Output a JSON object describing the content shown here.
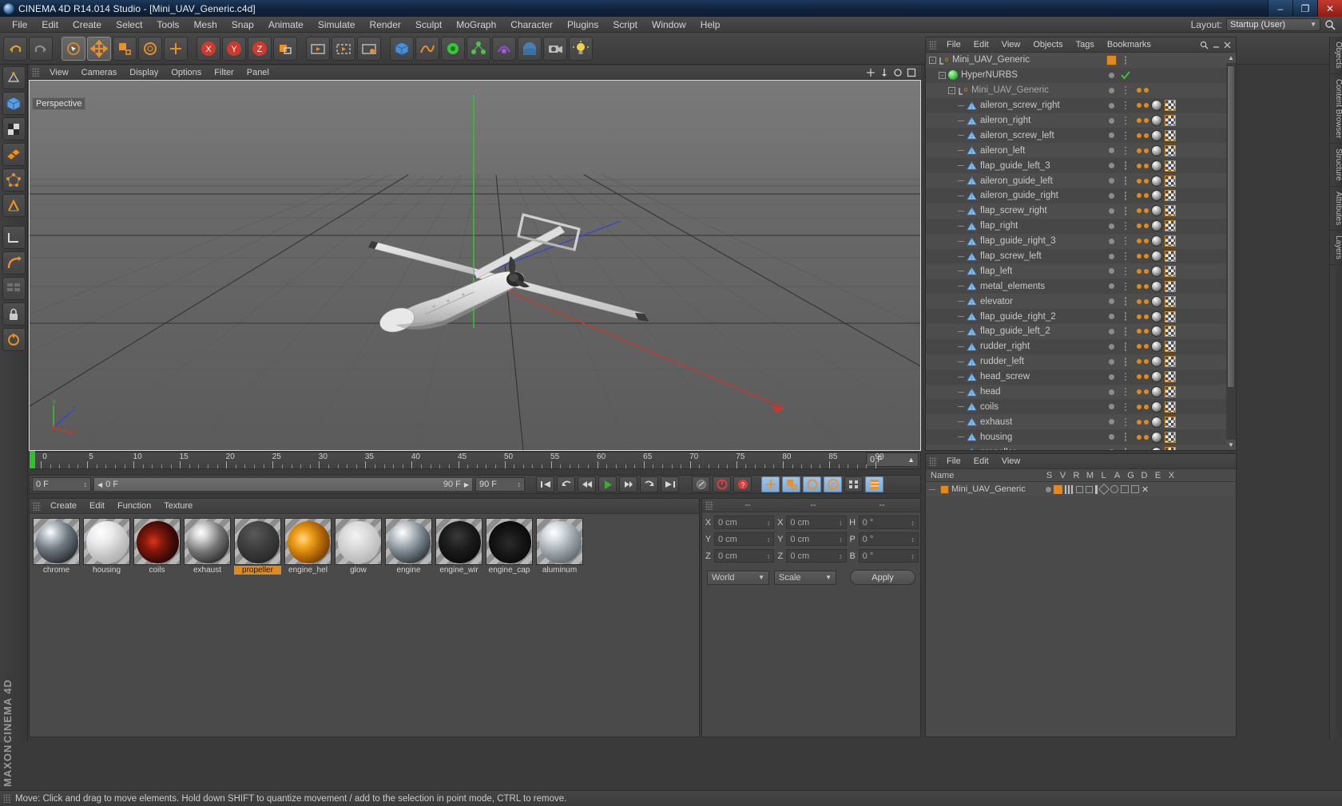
{
  "window": {
    "title": "CINEMA 4D R14.014 Studio - [Mini_UAV_Generic.c4d]",
    "app_icon": "c4d-app-icon",
    "minimize": "–",
    "maximize": "❐",
    "close": "✕"
  },
  "menubar": {
    "items": [
      "File",
      "Edit",
      "Create",
      "Select",
      "Tools",
      "Mesh",
      "Snap",
      "Animate",
      "Simulate",
      "Render",
      "Sculpt",
      "MoGraph",
      "Character",
      "Plugins",
      "Script",
      "Window",
      "Help"
    ],
    "layout_label": "Layout:",
    "layout_value": "Startup (User)",
    "search_icon": "search-icon"
  },
  "toolbar": {
    "buttons": [
      {
        "name": "undo-button",
        "icon": "undo-arrow-icon"
      },
      {
        "name": "redo-button",
        "icon": "redo-arrow-icon"
      },
      {
        "name": "live-selection-button",
        "icon": "cursor-selection-icon"
      },
      {
        "name": "move-tool-button",
        "icon": "move-arrows-icon"
      },
      {
        "name": "scale-tool-button",
        "icon": "scale-box-icon"
      },
      {
        "name": "rotate-tool-button",
        "icon": "rotate-circle-icon"
      },
      {
        "name": "add-tool-button",
        "icon": "plus-move-icon"
      },
      {
        "name": "lock-x-axis-button",
        "icon": "x-axis-icon"
      },
      {
        "name": "lock-y-axis-button",
        "icon": "y-axis-icon"
      },
      {
        "name": "lock-z-axis-button",
        "icon": "z-axis-icon"
      },
      {
        "name": "world-object-axis-button",
        "icon": "world-axis-icon"
      },
      {
        "name": "render-view-button",
        "icon": "render-view-icon"
      },
      {
        "name": "render-region-button",
        "icon": "render-region-icon"
      },
      {
        "name": "render-settings-button",
        "icon": "render-settings-icon"
      },
      {
        "name": "cube-primitive-button",
        "icon": "cube-icon"
      },
      {
        "name": "spline-button",
        "icon": "spline-icon"
      },
      {
        "name": "nurbs-button",
        "icon": "hypernurbs-icon"
      },
      {
        "name": "array-button",
        "icon": "array-icon"
      },
      {
        "name": "deformer-button",
        "icon": "deformer-icon"
      },
      {
        "name": "environment-button",
        "icon": "sky-icon"
      },
      {
        "name": "camera-button",
        "icon": "camera-icon"
      },
      {
        "name": "light-button",
        "icon": "light-bulb-icon"
      }
    ]
  },
  "left_palette": {
    "buttons": [
      {
        "name": "make-editable-tool",
        "icon": "make-editable-icon"
      },
      {
        "name": "model-mode-tool",
        "icon": "model-mode-icon"
      },
      {
        "name": "texture-mode-tool",
        "icon": "texture-mode-icon"
      },
      {
        "name": "polygon-mode-tool",
        "icon": "polygon-mode-icon"
      },
      {
        "name": "point-mode-tool",
        "icon": "point-mode-icon"
      },
      {
        "name": "edge-mode-tool",
        "icon": "edge-mode-icon"
      },
      {
        "name": "workplane-tool",
        "icon": "workplane-icon"
      },
      {
        "name": "enable-axis-tool",
        "icon": "axis-modify-icon"
      },
      {
        "name": "viewport-solo-tool",
        "icon": "viewport-solo-icon"
      },
      {
        "name": "lock-workplane-tool",
        "icon": "lock-icon"
      },
      {
        "name": "snap-tool",
        "icon": "snap-icon"
      }
    ],
    "brand_top": "MAXON",
    "brand_bottom": "CINEMA 4D"
  },
  "viewport": {
    "menu": [
      "View",
      "Cameras",
      "Display",
      "Options",
      "Filter",
      "Panel"
    ],
    "view_label": "Perspective",
    "corner_icons": [
      "pan-icon",
      "dolly-icon",
      "rotate-icon",
      "maximize-viewport-icon"
    ],
    "axis_labels": {
      "x": "X",
      "y": "Y",
      "z": "Z"
    }
  },
  "timeline": {
    "ticks": [
      0,
      5,
      10,
      15,
      20,
      25,
      30,
      35,
      40,
      45,
      50,
      55,
      60,
      65,
      70,
      75,
      80,
      85,
      90
    ],
    "end_field": "0 F",
    "playhead_frame": 0
  },
  "transport": {
    "current_frame_field": "0 F",
    "scrub_start": "0 F",
    "scrub_end": "90 F",
    "preview_end_field": "90 F",
    "buttons": [
      {
        "name": "go-to-start-button",
        "icon": "skip-start-icon"
      },
      {
        "name": "play-backwards-to-previous-key-button",
        "icon": "prev-key-icon"
      },
      {
        "name": "step-back-button",
        "icon": "step-back-icon"
      },
      {
        "name": "play-button",
        "icon": "play-icon"
      },
      {
        "name": "step-forward-button",
        "icon": "step-forward-icon"
      },
      {
        "name": "next-key-button",
        "icon": "next-key-icon"
      },
      {
        "name": "go-to-end-button",
        "icon": "skip-end-icon"
      },
      {
        "name": "autokey-button",
        "icon": "autokey-icon"
      },
      {
        "name": "record-active-objects-button",
        "icon": "record-icon"
      },
      {
        "name": "record-key-button",
        "icon": "key-record-icon"
      },
      {
        "name": "position-key-button",
        "icon": "position-key-icon"
      },
      {
        "name": "scale-key-button",
        "icon": "scale-key-icon"
      },
      {
        "name": "rotation-key-button",
        "icon": "rotation-key-icon"
      },
      {
        "name": "parameter-key-button",
        "icon": "param-key-icon"
      },
      {
        "name": "point-level-animation-button",
        "icon": "pla-icon"
      },
      {
        "name": "timeline-settings-button",
        "icon": "timeline-settings-icon"
      }
    ]
  },
  "material_manager": {
    "menu": [
      "Create",
      "Edit",
      "Function",
      "Texture"
    ],
    "selected": "propeller",
    "materials": [
      {
        "name": "chrome",
        "color": "radial-gradient(circle at 34% 26%, #ffffff 0%, #c9d1d6 14%, #6f7880 42%, #2b3036 78%, #14171a 100%)"
      },
      {
        "name": "housing",
        "color": "radial-gradient(circle at 34% 26%, #ffffff 0%, #ebebeb 28%, #c2c2c2 60%, #9a9a9a 100%)"
      },
      {
        "name": "coils",
        "color": "radial-gradient(circle at 40% 48%, #d9361b 0%, #8a1a0c 26%, #3a0a06 62%, #120302 100%)"
      },
      {
        "name": "exhaust",
        "color": "radial-gradient(circle at 33% 27%, #ffffff 0%, #d8d8d8 16%, #767676 46%, #2e2e2e 80%, #151515 100%)"
      },
      {
        "name": "propeller",
        "color": "radial-gradient(circle at 40% 30%, #5a5a5a 0%, #3e3e3e 40%, #262626 80%, #181818 100%)"
      },
      {
        "name": "engine_hel",
        "color": "radial-gradient(circle at 36% 42%, #ffd98a 0%, #f0a21a 24%, #a65c06 58%, #3a1d02 100%)"
      },
      {
        "name": "glow",
        "color": "radial-gradient(circle at 42% 34%, #f4f4f4 0%, #dcdcdc 32%, #bdbdbd 68%, #a0a0a0 100%)"
      },
      {
        "name": "engine",
        "color": "radial-gradient(circle at 33% 27%, #ffffff 0%, #d2d8dc 16%, #78838c 48%, #2c3237 82%, #14181c 100%)"
      },
      {
        "name": "engine_wir",
        "color": "radial-gradient(circle at 45% 36%, #3a3a3a 0%, #1b1b1b 40%, #0a0a0a 80%, #040404 100%)"
      },
      {
        "name": "engine_cap",
        "color": "radial-gradient(circle at 48% 52%, #2b2b2b 0%, #141414 45%, #060606 85%, #020202 100%)"
      },
      {
        "name": "aluminum",
        "color": "radial-gradient(circle at 34% 27%, #ffffff 0%, #dfe3e6 18%, #9aa2a8 50%, #5a6066 84%, #30343a 100%)"
      }
    ]
  },
  "coordinates": {
    "headers": [
      "--",
      "--",
      "--"
    ],
    "rows": [
      {
        "label1": "X",
        "value1": "0 cm",
        "label2": "X",
        "value2": "0 cm",
        "label3": "H",
        "value3": "0 °"
      },
      {
        "label1": "Y",
        "value1": "0 cm",
        "label2": "Y",
        "value2": "0 cm",
        "label3": "P",
        "value3": "0 °"
      },
      {
        "label1": "Z",
        "value1": "0 cm",
        "label2": "Z",
        "value2": "0 cm",
        "label3": "B",
        "value3": "0 °"
      }
    ],
    "space_dropdown": "World",
    "mode_dropdown": "Scale",
    "apply_button": "Apply"
  },
  "object_manager": {
    "menu": [
      "File",
      "Edit",
      "View",
      "Objects",
      "Tags",
      "Bookmarks"
    ],
    "items": [
      {
        "label": "Mini_UAV_Generic",
        "depth": 0,
        "icon": "null-object-icon",
        "expander": "-",
        "tag": "orange-swatch",
        "check": false
      },
      {
        "label": "HyperNURBS",
        "depth": 1,
        "icon": "hypernurbs-icon",
        "expander": "-",
        "tag": "none",
        "check": true
      },
      {
        "label": "Mini_UAV_Generic",
        "depth": 2,
        "icon": "null-object-icon",
        "expander": "-",
        "tag": "none",
        "check": false
      },
      {
        "label": "aileron_screw_right",
        "depth": 3,
        "icon": "polygon-object-icon",
        "expander": "",
        "tag": "material",
        "check": false
      },
      {
        "label": "aileron_right",
        "depth": 3,
        "icon": "polygon-object-icon",
        "expander": "",
        "tag": "material",
        "check": false
      },
      {
        "label": "aileron_screw_left",
        "depth": 3,
        "icon": "polygon-object-icon",
        "expander": "",
        "tag": "material",
        "check": false
      },
      {
        "label": "aileron_left",
        "depth": 3,
        "icon": "polygon-object-icon",
        "expander": "",
        "tag": "material",
        "check": false
      },
      {
        "label": "flap_guide_left_3",
        "depth": 3,
        "icon": "polygon-object-icon",
        "expander": "",
        "tag": "material",
        "check": false
      },
      {
        "label": "aileron_guide_left",
        "depth": 3,
        "icon": "polygon-object-icon",
        "expander": "",
        "tag": "material",
        "check": false
      },
      {
        "label": "aileron_guide_right",
        "depth": 3,
        "icon": "polygon-object-icon",
        "expander": "",
        "tag": "material",
        "check": false
      },
      {
        "label": "flap_screw_right",
        "depth": 3,
        "icon": "polygon-object-icon",
        "expander": "",
        "tag": "material",
        "check": false
      },
      {
        "label": "flap_right",
        "depth": 3,
        "icon": "polygon-object-icon",
        "expander": "",
        "tag": "material",
        "check": false
      },
      {
        "label": "flap_guide_right_3",
        "depth": 3,
        "icon": "polygon-object-icon",
        "expander": "",
        "tag": "material",
        "check": false
      },
      {
        "label": "flap_screw_left",
        "depth": 3,
        "icon": "polygon-object-icon",
        "expander": "",
        "tag": "material",
        "check": false
      },
      {
        "label": "flap_left",
        "depth": 3,
        "icon": "polygon-object-icon",
        "expander": "",
        "tag": "material",
        "check": false
      },
      {
        "label": "metal_elements",
        "depth": 3,
        "icon": "polygon-object-icon",
        "expander": "",
        "tag": "material",
        "check": false
      },
      {
        "label": "elevator",
        "depth": 3,
        "icon": "polygon-object-icon",
        "expander": "",
        "tag": "material",
        "check": false
      },
      {
        "label": "flap_guide_right_2",
        "depth": 3,
        "icon": "polygon-object-icon",
        "expander": "",
        "tag": "material",
        "check": false
      },
      {
        "label": "flap_guide_left_2",
        "depth": 3,
        "icon": "polygon-object-icon",
        "expander": "",
        "tag": "material",
        "check": false
      },
      {
        "label": "rudder_right",
        "depth": 3,
        "icon": "polygon-object-icon",
        "expander": "",
        "tag": "material",
        "check": false
      },
      {
        "label": "rudder_left",
        "depth": 3,
        "icon": "polygon-object-icon",
        "expander": "",
        "tag": "material",
        "check": false
      },
      {
        "label": "head_screw",
        "depth": 3,
        "icon": "polygon-object-icon",
        "expander": "",
        "tag": "material",
        "check": false
      },
      {
        "label": "head",
        "depth": 3,
        "icon": "polygon-object-icon",
        "expander": "",
        "tag": "material",
        "check": false
      },
      {
        "label": "coils",
        "depth": 3,
        "icon": "polygon-object-icon",
        "expander": "",
        "tag": "material",
        "check": false
      },
      {
        "label": "exhaust",
        "depth": 3,
        "icon": "polygon-object-icon",
        "expander": "",
        "tag": "material",
        "check": false
      },
      {
        "label": "housing",
        "depth": 3,
        "icon": "polygon-object-icon",
        "expander": "",
        "tag": "material",
        "check": false
      },
      {
        "label": "propeller",
        "depth": 3,
        "icon": "polygon-object-icon",
        "expander": "",
        "tag": "material",
        "check": false
      }
    ]
  },
  "attribute_manager": {
    "menu": [
      "File",
      "Edit",
      "View"
    ],
    "columns": [
      "Name",
      "S",
      "V",
      "R",
      "M",
      "L",
      "A",
      "G",
      "D",
      "E",
      "X"
    ],
    "rows": [
      {
        "label": "Mini_UAV_Generic",
        "icon": "orange-swatch-icon"
      }
    ]
  },
  "side_tabs": [
    "Objects",
    "Content Browser",
    "Structure",
    "Attributes",
    "Layers"
  ],
  "statusbar": {
    "text": "Move: Click and drag to move elements. Hold down SHIFT to quantize movement / add to the selection in point mode, CTRL to remove."
  }
}
